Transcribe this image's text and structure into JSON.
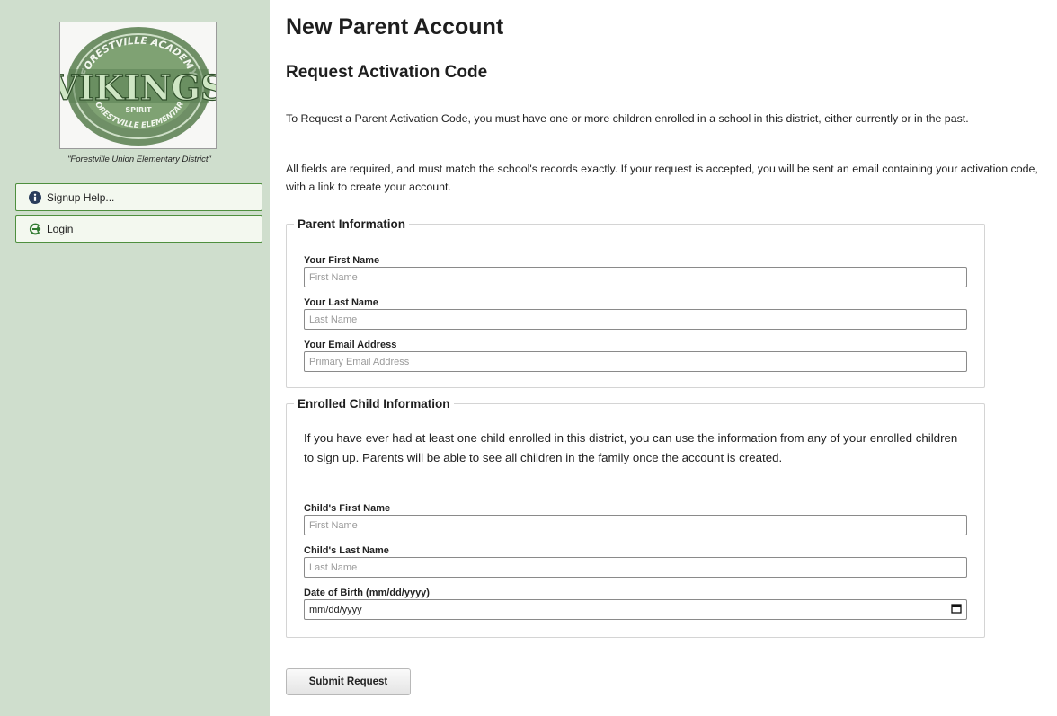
{
  "sidebar": {
    "logo": {
      "top_arc_text": "FORESTVILLE ACADEMY",
      "main_text": "VIKINGS",
      "spirit_text": "SPIRIT",
      "bottom_arc_text": "FORESTVILLE ELEMENTARY"
    },
    "district_caption": "\"Forestville Union Elementary District\"",
    "signup_help_label": "Signup Help...",
    "login_label": "Login",
    "colors": {
      "background": "#cfdecd",
      "button_border": "#4e8f3e"
    }
  },
  "main": {
    "title": "New Parent Account",
    "subtitle": "Request Activation Code",
    "intro_1": "To Request a Parent Activation Code, you must have one or more children enrolled in a school in this district, either currently or in the past.",
    "intro_2": "All fields are required, and must match the school's records exactly. If your request is accepted, you will be sent an email containing your activation code, with a link to create your account.",
    "parent_section": {
      "legend": "Parent Information",
      "first_name_label": "Your First Name",
      "first_name_placeholder": "First Name",
      "last_name_label": "Your Last Name",
      "last_name_placeholder": "Last Name",
      "email_label": "Your Email Address",
      "email_placeholder": "Primary Email Address"
    },
    "child_section": {
      "legend": "Enrolled Child Information",
      "description": "If you have ever had at least one child enrolled in this district, you can use the information from any of your enrolled children to sign up. Parents will be able to see all children in the family once the account is created.",
      "first_name_label": "Child's First Name",
      "first_name_placeholder": "First Name",
      "last_name_label": "Child's Last Name",
      "last_name_placeholder": "Last Name",
      "dob_label": "Date of Birth (mm/dd/yyyy)",
      "dob_value": "mm/dd/yyyy"
    },
    "submit_label": "Submit Request"
  }
}
